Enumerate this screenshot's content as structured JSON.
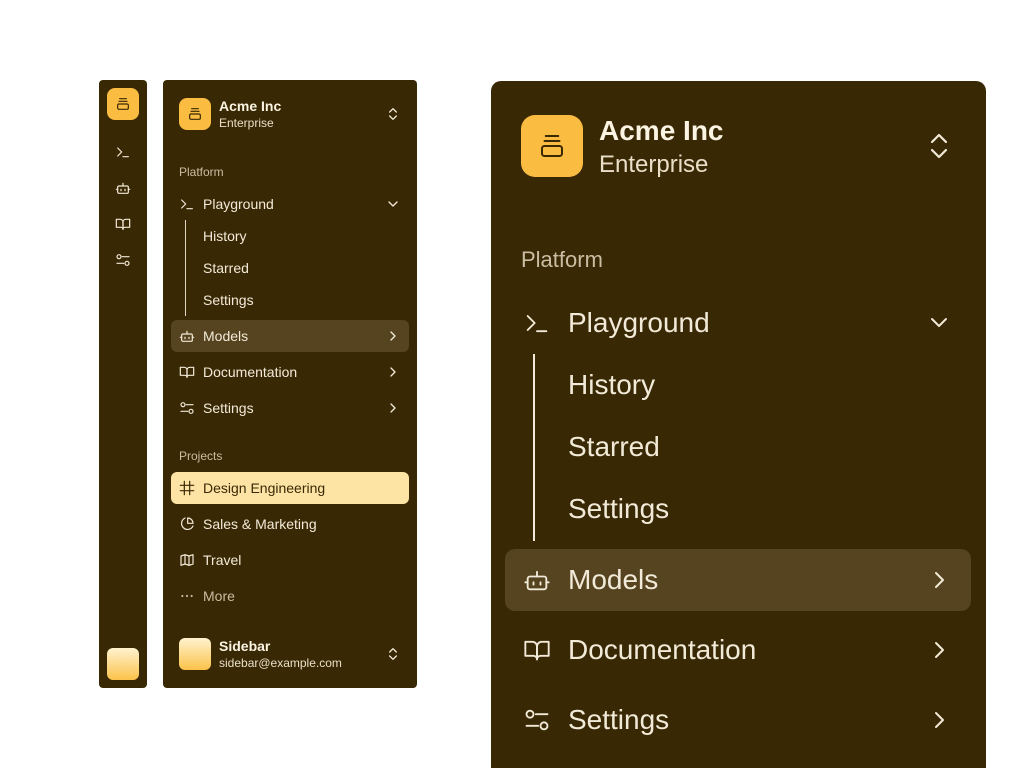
{
  "team": {
    "name": "Acme Inc",
    "plan": "Enterprise",
    "logo_icon": "stacked-tray-icon",
    "switcher_icon": "chevrons-up-down-icon"
  },
  "colors": {
    "sidebar_bg": "#392804",
    "accent": "#fbbd41",
    "active_item_bg": "#56431f",
    "active_project_bg": "#fde3a4",
    "text": "#f2ead8"
  },
  "platform": {
    "label": "Platform",
    "items": [
      {
        "label": "Playground",
        "icon": "terminal-icon",
        "state": "expanded",
        "children": [
          "History",
          "Starred",
          "Settings"
        ]
      },
      {
        "label": "Models",
        "icon": "bot-icon",
        "state": "collapsed",
        "active": true
      },
      {
        "label": "Documentation",
        "icon": "book-open-icon",
        "state": "collapsed"
      },
      {
        "label": "Settings",
        "icon": "sliders-icon",
        "state": "collapsed"
      }
    ]
  },
  "projects": {
    "label": "Projects",
    "items": [
      {
        "label": "Design Engineering",
        "icon": "hash-frame-icon",
        "active": true
      },
      {
        "label": "Sales & Marketing",
        "icon": "pie-chart-icon"
      },
      {
        "label": "Travel",
        "icon": "map-icon"
      },
      {
        "label": "More",
        "icon": "more-horizontal-icon"
      }
    ]
  },
  "user": {
    "name": "Sidebar",
    "email": "sidebar@example.com"
  }
}
